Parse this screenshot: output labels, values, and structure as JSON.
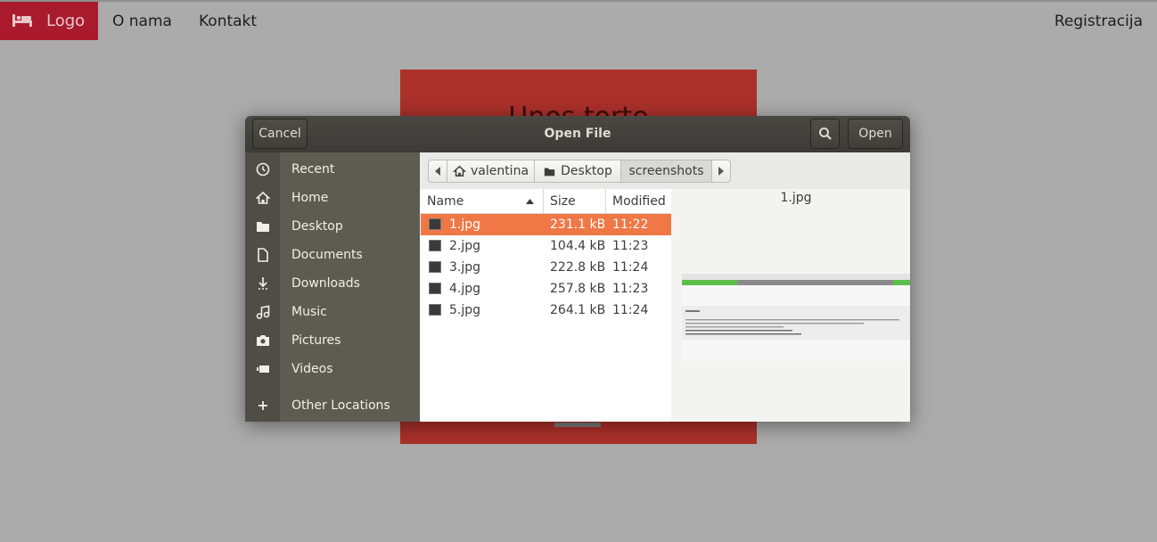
{
  "page": {
    "brand": "Logo",
    "nav": [
      "O nama",
      "Kontakt"
    ],
    "register": "Registracija",
    "panel_title": "Unos torte"
  },
  "dialog": {
    "title": "Open File",
    "cancel": "Cancel",
    "open": "Open",
    "sidebar": [
      {
        "label": "Recent",
        "icon": "clock-icon"
      },
      {
        "label": "Home",
        "icon": "home-icon"
      },
      {
        "label": "Desktop",
        "icon": "folder-icon"
      },
      {
        "label": "Documents",
        "icon": "document-icon"
      },
      {
        "label": "Downloads",
        "icon": "download-icon"
      },
      {
        "label": "Music",
        "icon": "music-icon"
      },
      {
        "label": "Pictures",
        "icon": "camera-icon"
      },
      {
        "label": "Videos",
        "icon": "video-icon"
      }
    ],
    "other_locations": "Other Locations",
    "path": [
      "valentina",
      "Desktop",
      "screenshots"
    ],
    "columns": {
      "name": "Name",
      "size": "Size",
      "modified": "Modified"
    },
    "files": [
      {
        "name": "1.jpg",
        "size": "231.1 kB",
        "modified": "11:22",
        "selected": true
      },
      {
        "name": "2.jpg",
        "size": "104.4 kB",
        "modified": "11:23"
      },
      {
        "name": "3.jpg",
        "size": "222.8 kB",
        "modified": "11:24"
      },
      {
        "name": "4.jpg",
        "size": "257.8 kB",
        "modified": "11:23"
      },
      {
        "name": "5.jpg",
        "size": "264.1 kB",
        "modified": "11:24"
      }
    ],
    "preview_name": "1.jpg"
  },
  "colors": {
    "brand": "#a81a2c",
    "panel": "#ab302a",
    "selection": "#f07746",
    "header": "#3c3b37",
    "sidebar": "#5e5b52"
  }
}
